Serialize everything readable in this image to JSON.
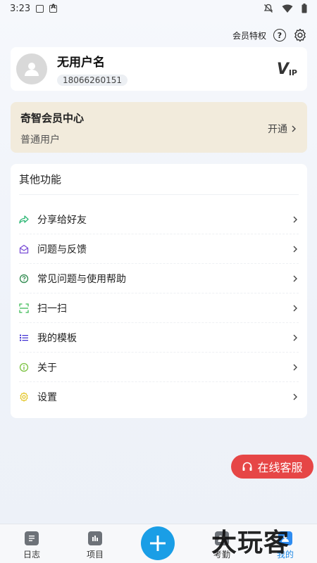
{
  "status": {
    "time": "3:23"
  },
  "top": {
    "vip_privilege": "会员特权"
  },
  "user": {
    "name": "无用户名",
    "phone": "18066260151",
    "vip_badge": "V",
    "vip_badge_small": "IP"
  },
  "vip_center": {
    "title": "奇智会员中心",
    "subtitle": "普通用户",
    "action": "开通"
  },
  "functions": {
    "title": "其他功能",
    "items": [
      {
        "label": "分享给好友",
        "icon": "share-icon",
        "color": "#2bb673"
      },
      {
        "label": "问题与反馈",
        "icon": "mail-icon",
        "color": "#7b4fd6"
      },
      {
        "label": "常见问题与使用帮助",
        "icon": "help-icon",
        "color": "#2f8a4e"
      },
      {
        "label": "扫一扫",
        "icon": "scan-icon",
        "color": "#3cba54"
      },
      {
        "label": "我的模板",
        "icon": "list-icon",
        "color": "#3b2bd1"
      },
      {
        "label": "关于",
        "icon": "info-icon",
        "color": "#7cc242"
      },
      {
        "label": "设置",
        "icon": "gear-icon",
        "color": "#e3c420"
      }
    ]
  },
  "service": {
    "label": "在线客服"
  },
  "nav": [
    {
      "label": "日志",
      "icon": "log-icon"
    },
    {
      "label": "项目",
      "icon": "project-icon"
    },
    {
      "label": "考勤",
      "icon": "attendance-icon"
    },
    {
      "label": "我的",
      "icon": "me-icon"
    }
  ],
  "watermark": {
    "text": "大玩客"
  }
}
